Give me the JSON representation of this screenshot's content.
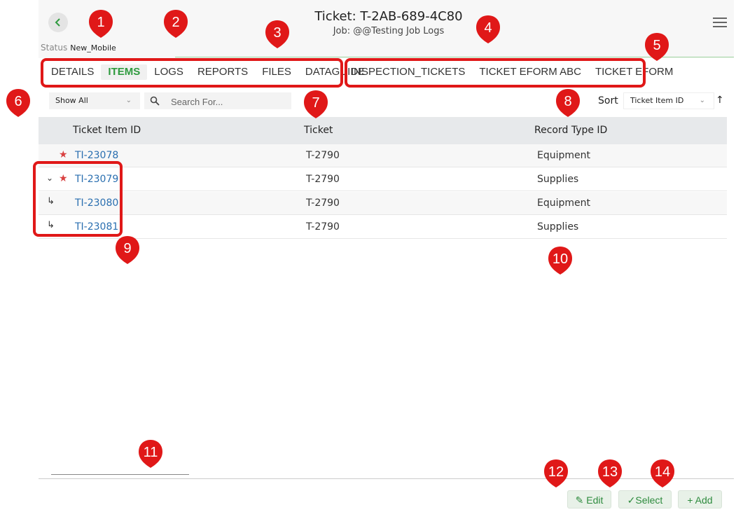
{
  "header": {
    "title": "Ticket: T-2AB-689-4C80",
    "subtitle": "Job: @@Testing Job Logs",
    "status_label": "Status",
    "status_value": "New_Mobile"
  },
  "tabs": [
    {
      "label": "DETAILS",
      "active": false
    },
    {
      "label": "ITEMS",
      "active": true
    },
    {
      "label": "LOGS",
      "active": false
    },
    {
      "label": "REPORTS",
      "active": false
    },
    {
      "label": "FILES",
      "active": false
    },
    {
      "label": "DATAGUIDE",
      "active": false
    },
    {
      "label": "INSPECTION_TICKETS",
      "active": false
    },
    {
      "label": "TICKET EFORM ABC",
      "active": false
    },
    {
      "label": "TICKET EFORM",
      "active": false
    }
  ],
  "toolbar": {
    "filter_value": "Show All",
    "search_placeholder": "Search For...",
    "sort_label": "Sort",
    "sort_value": "Ticket Item ID"
  },
  "table": {
    "columns": [
      "Ticket Item ID",
      "Ticket",
      "Record Type ID"
    ],
    "rows": [
      {
        "id": "TI-23078",
        "ticket": "T-2790",
        "record_type": "Equipment"
      },
      {
        "id": "TI-23079",
        "ticket": "T-2790",
        "record_type": "Supplies"
      },
      {
        "id": "TI-23080",
        "ticket": "T-2790",
        "record_type": "Equipment"
      },
      {
        "id": "TI-23081",
        "ticket": "T-2790",
        "record_type": "Supplies"
      }
    ]
  },
  "actions": {
    "edit": "Edit",
    "select": "Select",
    "add": "+ Add"
  },
  "callouts": [
    "1",
    "2",
    "3",
    "4",
    "5",
    "6",
    "7",
    "8",
    "9",
    "10",
    "11",
    "12",
    "13",
    "14"
  ],
  "colors": {
    "accent_green": "#2e9a3e",
    "callout_red": "#e01818",
    "link_blue": "#2a6fb0",
    "star_red": "#d94040"
  }
}
